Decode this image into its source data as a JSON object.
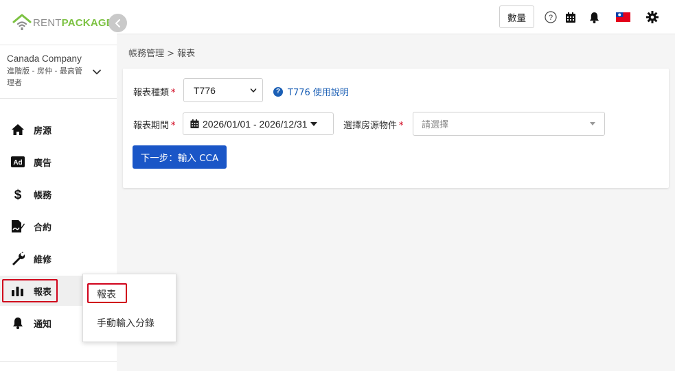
{
  "brand": {
    "logo_text_rent": "RENT",
    "logo_text_package": "PACKAGE",
    "colors": {
      "green": "#7cc242",
      "gray": "#8c8c8c",
      "primary": "#1a56c7",
      "required": "#d0021b"
    }
  },
  "sidebar": {
    "company_name": "Canada Company",
    "company_plan": "進階版 - 房仲 - 最高管理者",
    "nav_items": [
      {
        "label": "房源",
        "icon": "home-icon"
      },
      {
        "label": "廣告",
        "icon": "ad-icon"
      },
      {
        "label": "帳務",
        "icon": "dollar-icon"
      },
      {
        "label": "合約",
        "icon": "contract-icon"
      },
      {
        "label": "維修",
        "icon": "wrench-icon"
      },
      {
        "label": "報表",
        "icon": "bar-chart-icon",
        "active": true
      },
      {
        "label": "通知",
        "icon": "bell-icon"
      }
    ]
  },
  "flyout": {
    "items": [
      {
        "label": "報表"
      },
      {
        "label": "手動輸入分錄"
      }
    ]
  },
  "topbar": {
    "qty_label": "數量",
    "icons": [
      "help-icon",
      "calendar-icon",
      "bell-icon",
      "taiwan-flag-icon",
      "gear-icon"
    ]
  },
  "breadcrumb": "帳務管理 > 報表",
  "form": {
    "report_type_label": "報表種類",
    "report_type_value": "T776",
    "help_text": "T776 使用說明",
    "period_label": "報表期間",
    "period_value": "2026/01/01 - 2026/12/31",
    "property_label": "選擇房源物件",
    "property_placeholder": "請選擇",
    "required_mark": "*",
    "next_button": "下一步：輸入 CCA"
  }
}
